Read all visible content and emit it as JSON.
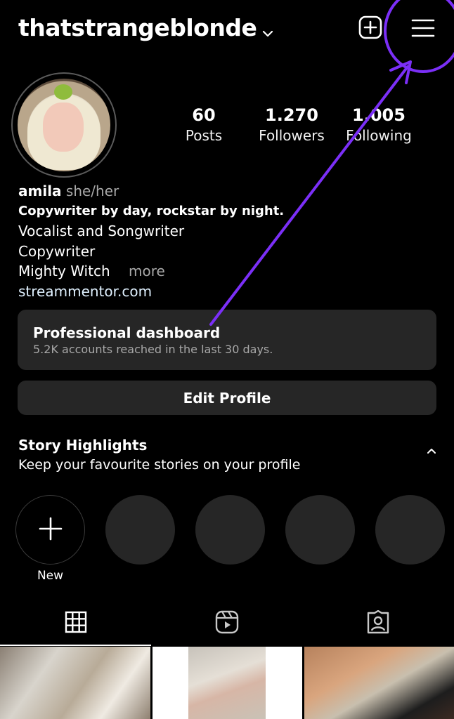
{
  "header": {
    "username": "thatstrangeblonde"
  },
  "profile": {
    "stats": [
      {
        "value": "60",
        "label": "Posts"
      },
      {
        "value": "1.270",
        "label": "Followers"
      },
      {
        "value": "1.005",
        "label": "Following"
      }
    ],
    "name": "amila",
    "pronouns": "she/her",
    "bio_lines": [
      "Copywriter by day, rockstar by night.",
      "Vocalist and Songwriter",
      "Copywriter",
      "Mighty Witch"
    ],
    "more_label": "more",
    "link": "streammentor.com"
  },
  "dashboard": {
    "title": "Professional dashboard",
    "subtitle": "5.2K accounts reached in the last 30 days."
  },
  "edit_profile_label": "Edit Profile",
  "highlights": {
    "title": "Story Highlights",
    "subtitle": "Keep your favourite stories on your profile",
    "new_label": "New"
  },
  "colors": {
    "annotation": "#7b2ff7",
    "card": "#262626",
    "muted_text": "#a8a8a8"
  },
  "icons": [
    "chevron-down-icon",
    "add-post-icon",
    "menu-icon",
    "plus-icon",
    "chevron-up-icon",
    "grid-icon",
    "reels-icon",
    "tagged-icon"
  ]
}
